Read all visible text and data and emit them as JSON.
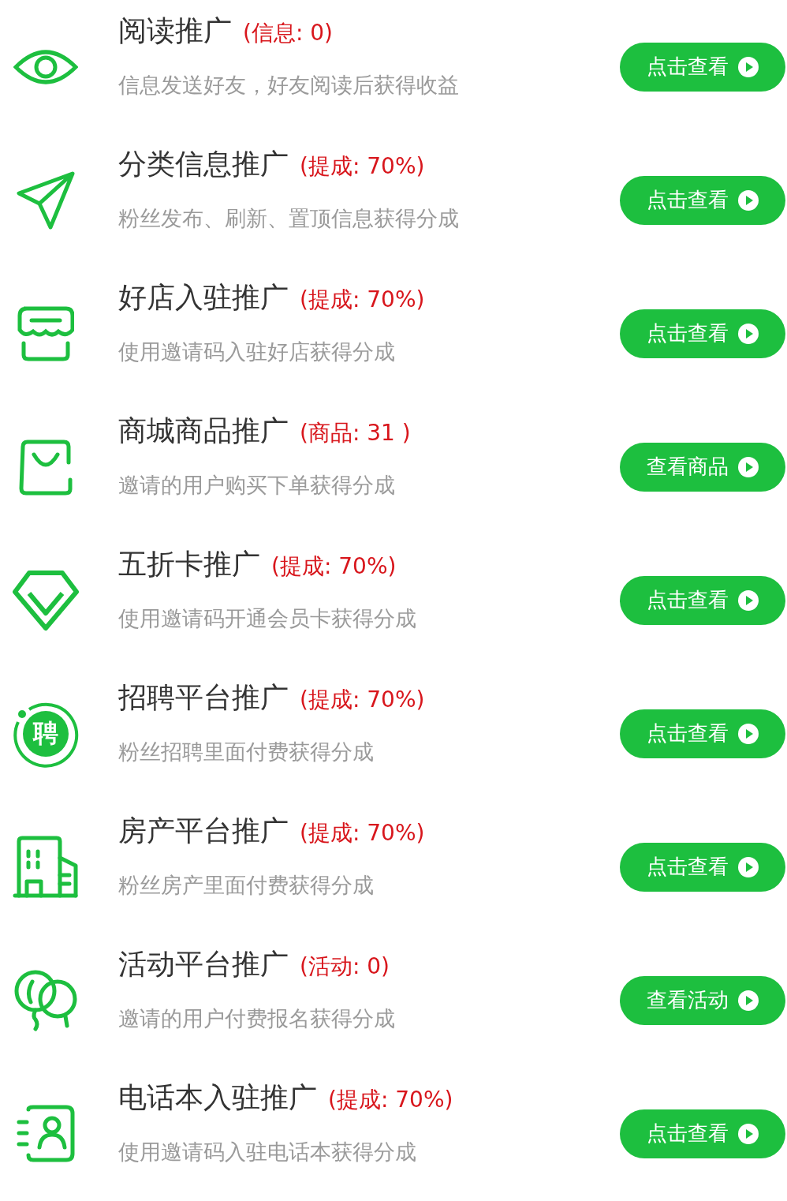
{
  "items": [
    {
      "kind": "eye",
      "title": "阅读推广",
      "tag": "(信息: 0)",
      "description": "信息发送好友，好友阅读后获得收益",
      "button": "点击查看"
    },
    {
      "kind": "send",
      "title": "分类信息推广",
      "tag": "(提成: 70%)",
      "description": "粉丝发布、刷新、置顶信息获得分成",
      "button": "点击查看"
    },
    {
      "kind": "store",
      "title": "好店入驻推广",
      "tag": "(提成: 70%)",
      "description": "使用邀请码入驻好店获得分成",
      "button": "点击查看"
    },
    {
      "kind": "bag",
      "title": "商城商品推广",
      "tag": "(商品: 31 )",
      "description": "邀请的用户购买下单获得分成",
      "button": "查看商品"
    },
    {
      "kind": "diamond",
      "title": "五折卡推广",
      "tag": "(提成: 70%)",
      "description": "使用邀请码开通会员卡获得分成",
      "button": "点击查看"
    },
    {
      "kind": "badge",
      "badge": "聘",
      "title": "招聘平台推广",
      "tag": "(提成: 70%)",
      "description": "粉丝招聘里面付费获得分成",
      "button": "点击查看"
    },
    {
      "kind": "building",
      "title": "房产平台推广",
      "tag": "(提成: 70%)",
      "description": "粉丝房产里面付费获得分成",
      "button": "点击查看"
    },
    {
      "kind": "balloon",
      "title": "活动平台推广",
      "tag": "(活动: 0)",
      "description": "邀请的用户付费报名获得分成",
      "button": "查看活动"
    },
    {
      "kind": "contacts",
      "title": "电话本入驻推广",
      "tag": "(提成: 70%)",
      "description": "使用邀请码入驻电话本获得分成",
      "button": "点击查看"
    }
  ]
}
